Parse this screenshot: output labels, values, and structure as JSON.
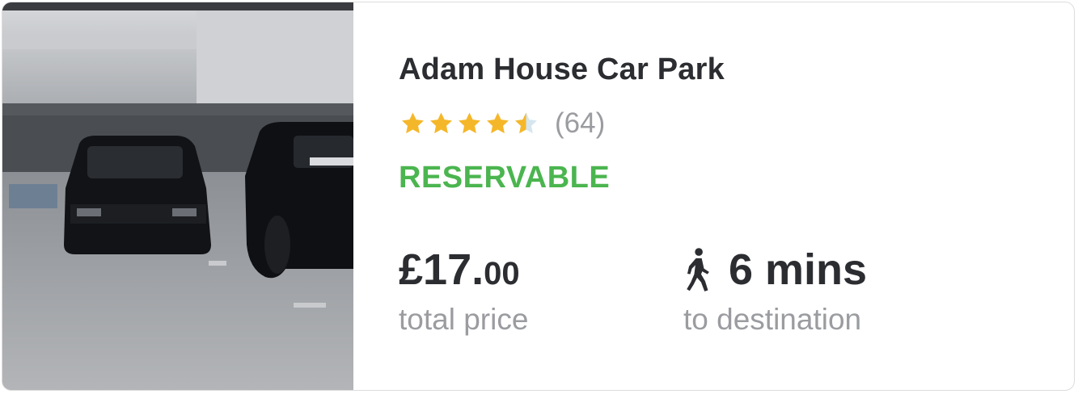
{
  "listing": {
    "title": "Adam House Car Park",
    "rating": 4.5,
    "rating_max": 5,
    "review_count": "(64)",
    "status": "RESERVABLE",
    "price_main": "£17.",
    "price_cents": "00",
    "price_label": "total price",
    "walk_time": "6 mins",
    "walk_label": "to destination",
    "walk_icon": "walking-person-icon"
  },
  "colors": {
    "star": "#f5b72a",
    "star_empty": "#d6e6ef",
    "status": "#4bb54f",
    "text": "#2b2d31",
    "muted": "#9a9ca0"
  }
}
